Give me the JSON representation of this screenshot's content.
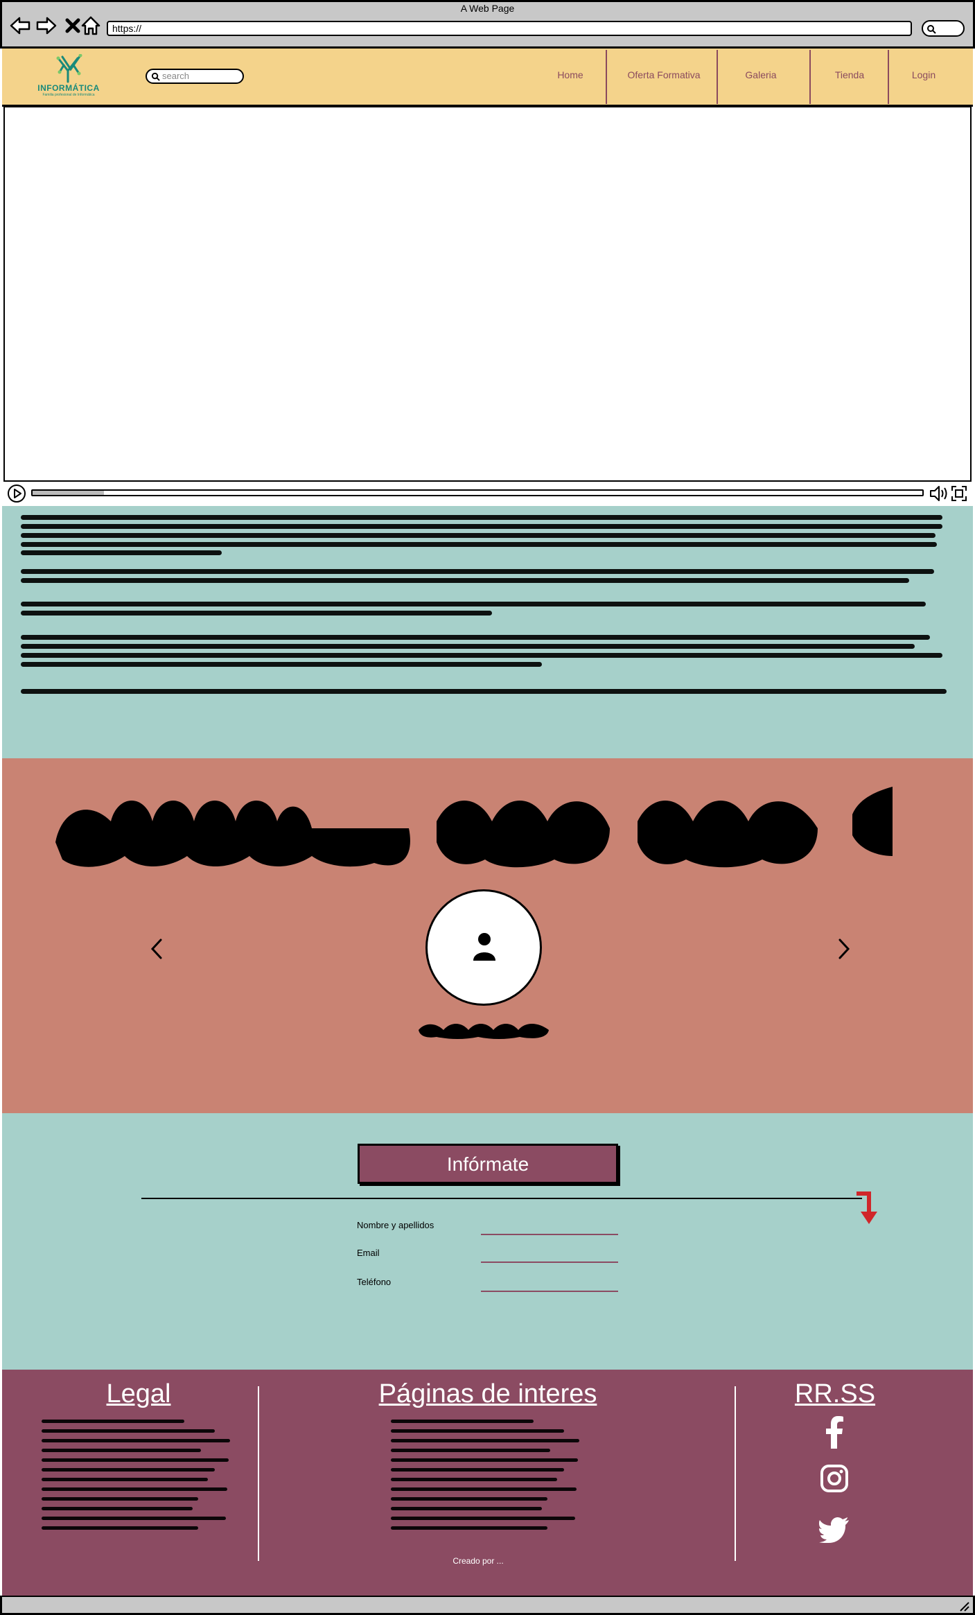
{
  "browser": {
    "window_title": "A Web Page",
    "url": "https://"
  },
  "header": {
    "logo_text": "INFORMÁTICA",
    "logo_subtext": "Familia profesional de Informática",
    "search_placeholder": "search",
    "nav": [
      "Home",
      "Oferta Formativa",
      "Galeria",
      "Tienda",
      "Login"
    ]
  },
  "video": {
    "progress": 0.08
  },
  "form": {
    "button_label": "Infórmate",
    "fields": [
      "Nombre y apellidos",
      "Email",
      "Teléfono"
    ]
  },
  "footer": {
    "legal_title": "Legal",
    "pages_title": "Páginas de interes",
    "social_title": "RR.SS",
    "social_icons": [
      "facebook-icon",
      "instagram-icon",
      "twitter-icon"
    ],
    "credit": "Creado por ..."
  },
  "colors": {
    "header_bg": "#f4d38b",
    "teal_bg": "#a6d0ca",
    "salmon_bg": "#c98373",
    "plum": "#8b4b62",
    "arrow_red": "#d0262a"
  }
}
